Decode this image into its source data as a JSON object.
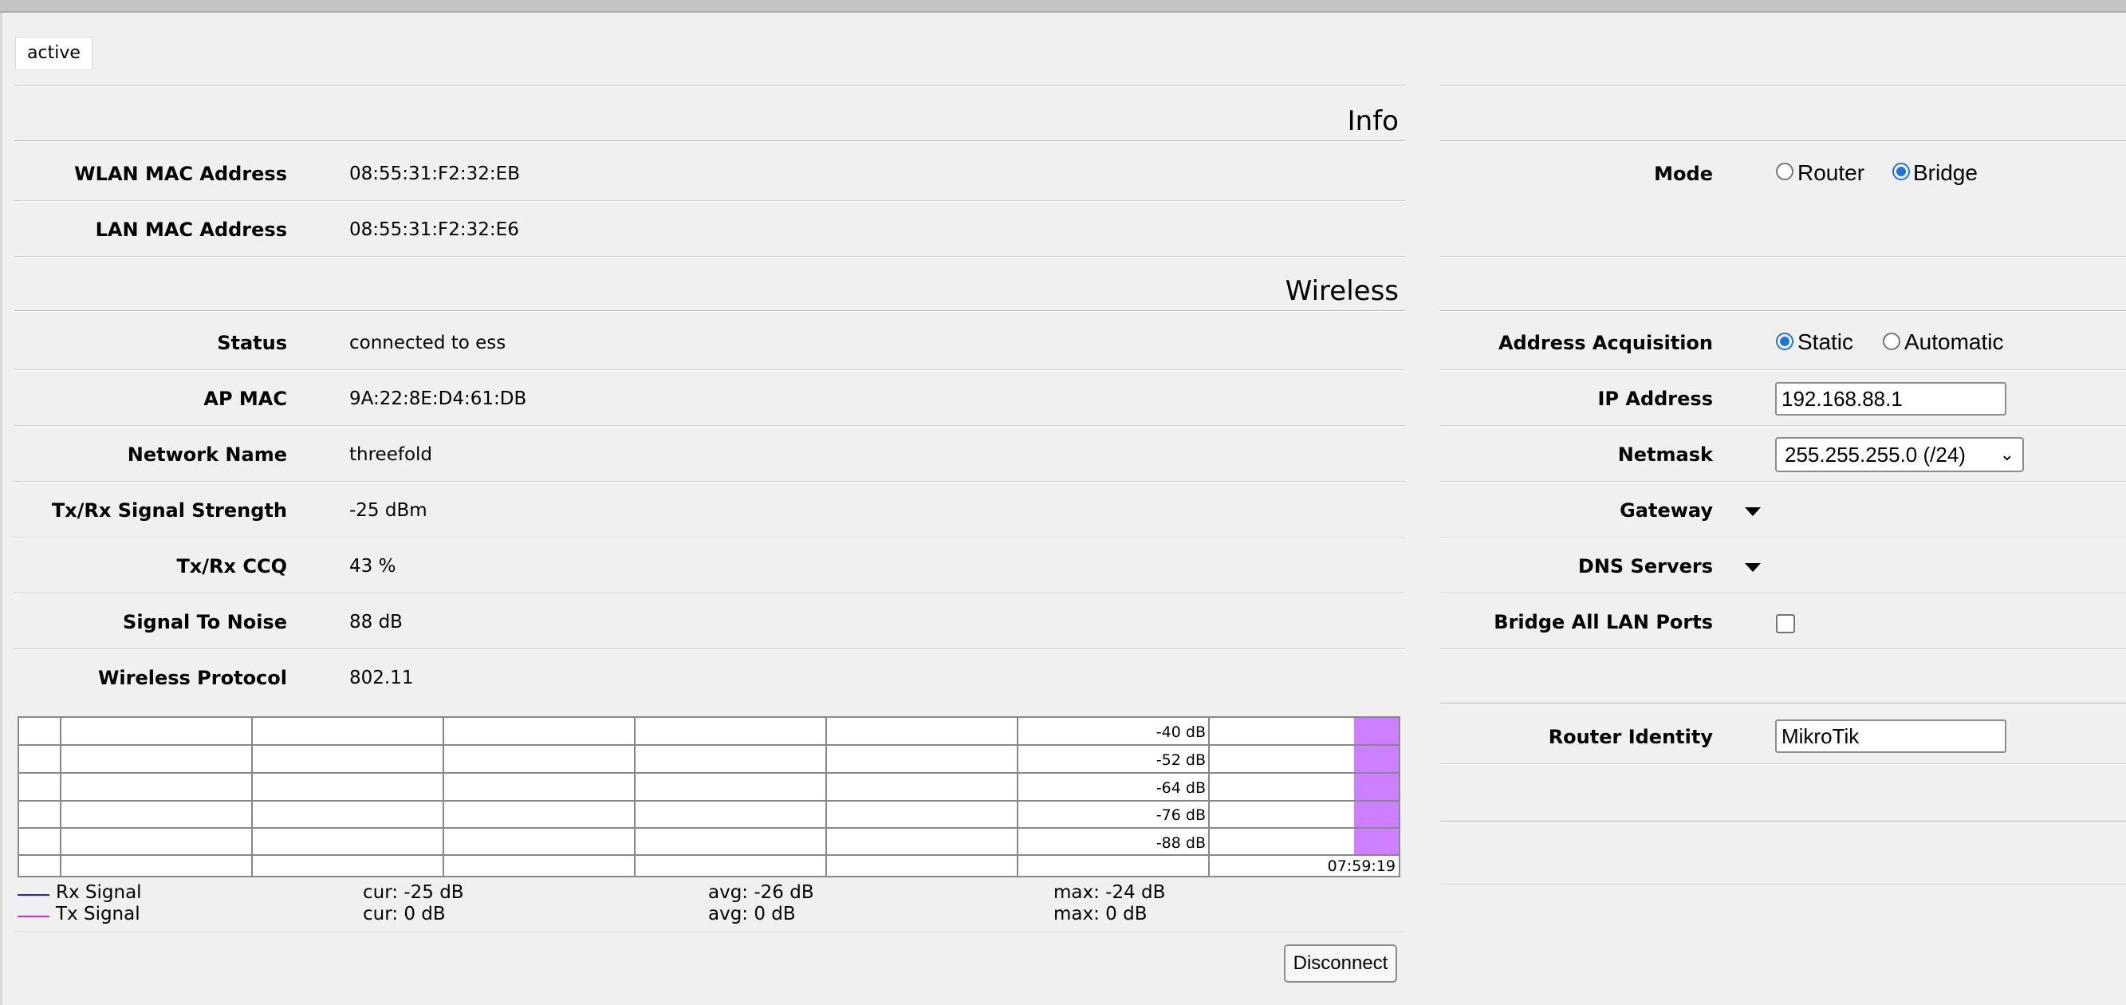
{
  "tab": "active",
  "info": {
    "title": "Info",
    "rows": [
      {
        "label": "WLAN MAC Address",
        "value": "08:55:31:F2:32:EB"
      },
      {
        "label": "LAN MAC Address",
        "value": "08:55:31:F2:32:E6"
      }
    ]
  },
  "wireless": {
    "title": "Wireless",
    "rows": [
      {
        "label": "Status",
        "value": "connected to ess"
      },
      {
        "label": "AP MAC",
        "value": "9A:22:8E:D4:61:DB"
      },
      {
        "label": "Network Name",
        "value": "threefold"
      },
      {
        "label": "Tx/Rx Signal Strength",
        "value": "-25 dBm"
      },
      {
        "label": "Tx/Rx CCQ",
        "value": "43 %"
      },
      {
        "label": "Signal To Noise",
        "value": "88 dB"
      },
      {
        "label": "Wireless Protocol",
        "value": "802.11"
      }
    ]
  },
  "graph": {
    "db_labels": [
      "-40 dB",
      "-52 dB",
      "-64 dB",
      "-76 dB",
      "-88 dB"
    ],
    "time_label": "07:59:19",
    "highlight_color": "#cc80ff"
  },
  "legend": {
    "rx": {
      "label": "Rx Signal",
      "color": "#2222cc",
      "cur": "cur: -25 dB",
      "avg": "avg: -26 dB",
      "max": "max: -24 dB"
    },
    "tx": {
      "label": "Tx Signal",
      "color": "#dd22dd",
      "cur": "cur: 0 dB",
      "avg": "avg: 0 dB",
      "max": "max: 0 dB"
    }
  },
  "disconnect_label": "Disconnect",
  "settings": {
    "mode_label": "Mode",
    "mode_router": "Router",
    "mode_bridge": "Bridge",
    "mode_selected": "Bridge",
    "acq_label": "Address Acquisition",
    "acq_static": "Static",
    "acq_automatic": "Automatic",
    "acq_selected": "Static",
    "ip_label": "IP Address",
    "ip_value": "192.168.88.1",
    "netmask_label": "Netmask",
    "netmask_value": "255.255.255.0 (/24)",
    "gateway_label": "Gateway",
    "dns_label": "DNS Servers",
    "bridge_ports_label": "Bridge All LAN Ports",
    "bridge_ports_checked": false,
    "identity_label": "Router Identity",
    "identity_value": "MikroTik"
  },
  "colors": {
    "accent": "#1a73e8",
    "background": "#f0f0f0"
  }
}
